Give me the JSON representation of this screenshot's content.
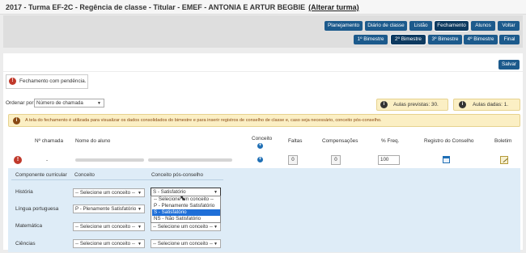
{
  "header": {
    "title": "2017 - Turma EF-2C - Regência de classe - Titular - EMEF - ANTONIA E ARTUR BEGBIE",
    "change_link": "(Alterar turma)"
  },
  "nav": {
    "planejamento": "Planejamento",
    "diario": "Diário de classe",
    "listao": "Listão",
    "fechamento": "Fechamento",
    "alunos": "Alunos",
    "voltar": "Voltar",
    "bim1": "1º Bimestre",
    "bim2": "2º Bimestre",
    "bim3": "3º Bimestre",
    "bim4": "4º Bimestre",
    "final": "Final"
  },
  "salvar": "Salvar",
  "alert_pendencia": "Fechamento com pendência.",
  "ordenar": {
    "label": "Ordenar por:",
    "value": "Número de chamada"
  },
  "aulas_previstas": "Aulas previstas: 30.",
  "aulas_dadas": "Aulas dadas: 1.",
  "info_message": "A tela do fechamento é utilizada para visualizar os dados consolidados do bimestre e para inserir registros de conselho de classe e, caso seja necessário, conceito pós-conselho.",
  "table": {
    "headers": {
      "numero": "Nº chamada",
      "nome": "Nome do aluno",
      "conceito": "Conceito",
      "faltas": "Faltas",
      "compensacoes": "Compensações",
      "freq": "% Freq.",
      "registro": "Registro do Conselho",
      "boletim": "Boletim"
    },
    "row": {
      "numero": "-",
      "faltas": "0",
      "compensacoes": "0",
      "freq": "100"
    }
  },
  "subtable": {
    "headers": {
      "componente": "Componente curricular",
      "conceito": "Conceito",
      "pos": "Conceito pós-conselho"
    },
    "rows": [
      {
        "componente": "História",
        "conceito": "-- Selecione um conceito --",
        "pos": "S - Satisfatório"
      },
      {
        "componente": "Língua portuguesa",
        "conceito": "P - Plenamente Satisfatório",
        "pos": ""
      },
      {
        "componente": "Matemática",
        "conceito": "-- Selecione um conceito --",
        "pos": "-- Selecione um conceito --"
      },
      {
        "componente": "Ciências",
        "conceito": "-- Selecione um conceito --",
        "pos": "-- Selecione um conceito --"
      }
    ],
    "dropdown_options": [
      "-- Selecione um conceito --",
      "P - Plenamente Satisfatório",
      "S - Satisfatório",
      "NS - Não Satisfatório"
    ],
    "dropdown_selected": "S - Satisfatório"
  },
  "colors": {
    "nav_button": "#1c5a8c",
    "alert_icon": "#c0392b",
    "info_bg": "#fbefc4",
    "subtable_bg": "#deecf7",
    "selected_option": "#1f6fd8"
  }
}
